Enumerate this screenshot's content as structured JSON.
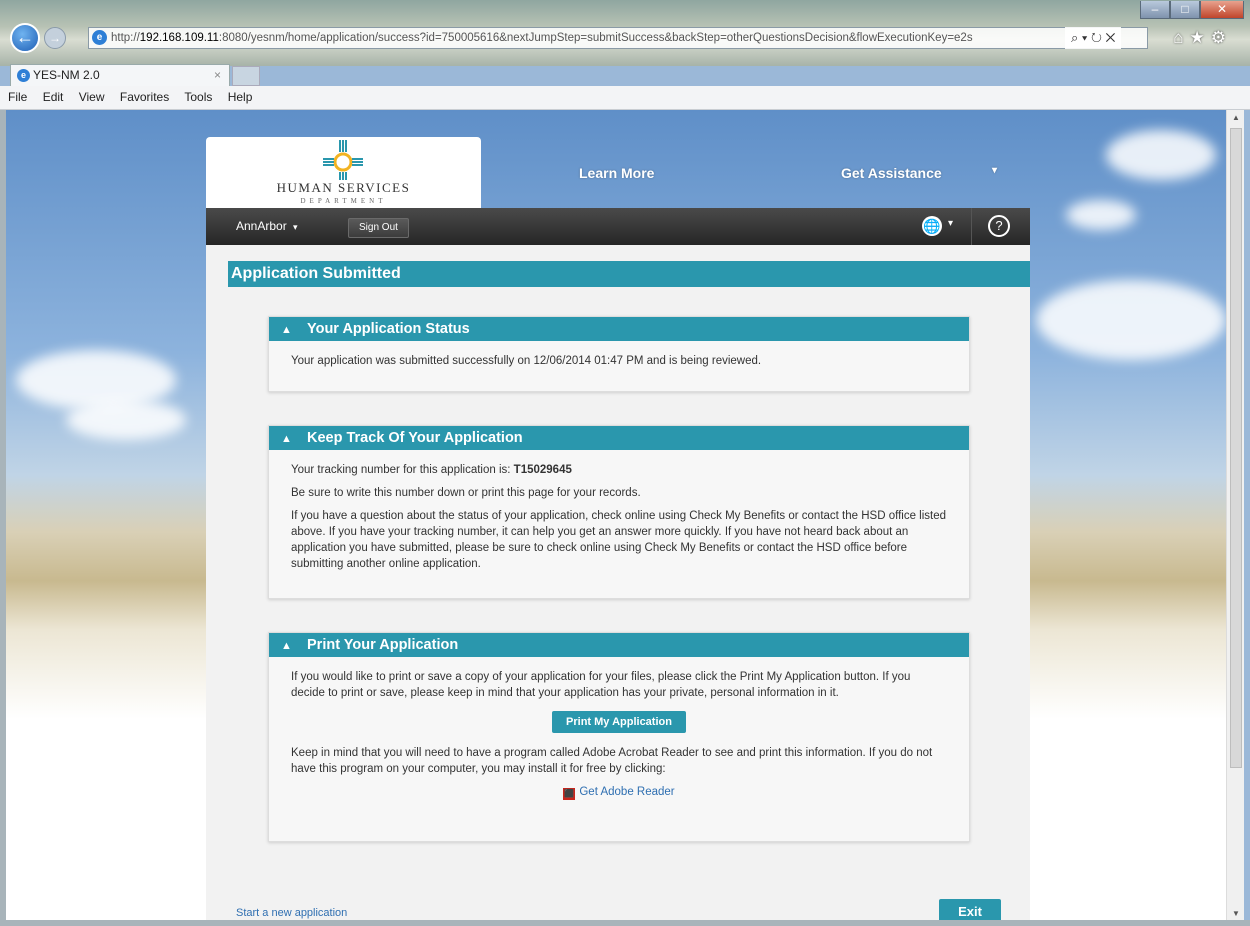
{
  "browser": {
    "url_prefix": "http://",
    "url_host": "192.168.109.11",
    "url_rest": ":8080/yesnm/home/application/success?id=750005616&nextJumpStep=submitSuccess&backStep=otherQuestionsDecision&flowExecutionKey=e2s",
    "tab_title": "YES-NM 2.0",
    "menu": [
      "File",
      "Edit",
      "View",
      "Favorites",
      "Tools",
      "Help"
    ],
    "address_tools": "⌕ ▾ ↻ ✕",
    "fav_icons": "⌂★⚙"
  },
  "header": {
    "logo_text": "HUMAN SERVICES",
    "logo_dept": "DEPARTMENT",
    "learn_more": "Learn More",
    "get_assistance": "Get Assistance",
    "get_assistance_caret": "▾",
    "user": "AnnArbor",
    "user_caret": "▾",
    "sign_out": "Sign Out",
    "globe_caret": "▾",
    "help": "?"
  },
  "page": {
    "title": "Application Submitted"
  },
  "status_card": {
    "heading": "Your Application Status",
    "text": "Your application was submitted successfully on 12/06/2014 01:47 PM and is being reviewed."
  },
  "track_card": {
    "heading": "Keep Track Of Your Application",
    "tracking_prefix": "Your tracking number for this application is: ",
    "tracking_number": "T15029645",
    "line2": "Be sure to write this number down or print this page for your records.",
    "line3": "If you have a question about the status of your application, check online using Check My Benefits or contact the HSD office listed above. If you have your tracking number, it can help you get an answer more quickly. If you have not heard back about an application you have submitted, please be sure to check online using Check My Benefits or contact the HSD office before submitting another online application."
  },
  "print_card": {
    "heading": "Print Your Application",
    "text1": "If you would like to print or save a copy of your application for your files, please click the Print My Application button. If you decide to print or save, please keep in mind that your application has your private, personal information in it.",
    "button": "Print My Application",
    "text2": "Keep in mind that you will need to have a program called Adobe Acrobat Reader to see and print this information. If you do not have this program on your computer, you may install it for free by clicking:",
    "adobe_link": "Get Adobe Reader"
  },
  "footer": {
    "start_new": "Start a new application",
    "exit": "Exit"
  },
  "colors": {
    "accent": "#2a97ad",
    "dark_bar": "#2e2e2e",
    "link": "#2f6fb1"
  }
}
